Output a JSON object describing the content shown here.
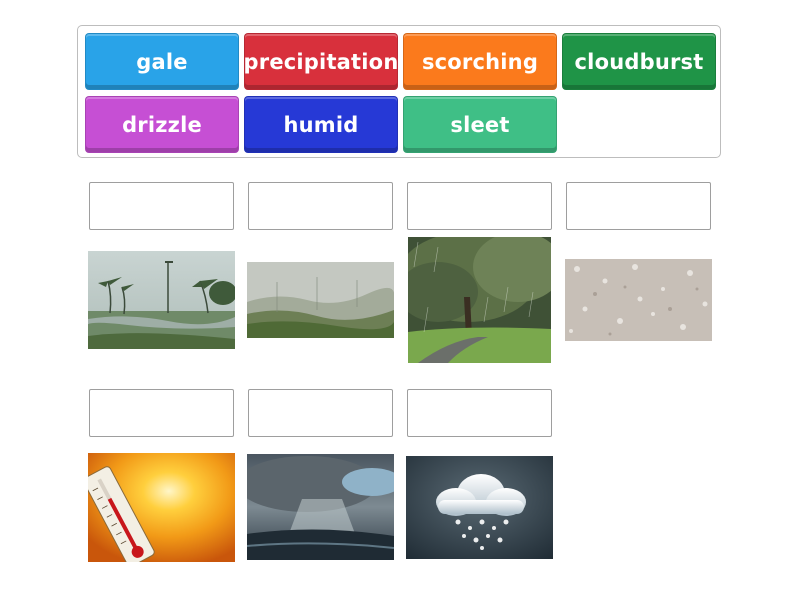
{
  "word_bank": {
    "tiles": [
      {
        "label": "gale",
        "color": "#29a3e8"
      },
      {
        "label": "precipitation",
        "color": "#d8303c"
      },
      {
        "label": "scorching",
        "color": "#fb7a1c"
      },
      {
        "label": "cloudburst",
        "color": "#1f9447"
      },
      {
        "label": "drizzle",
        "color": "#c64fd4"
      },
      {
        "label": "humid",
        "color": "#2639d6"
      },
      {
        "label": "sleet",
        "color": "#3fbf86"
      }
    ]
  },
  "images": [
    {
      "icon": "windswept-palm-trees-image"
    },
    {
      "icon": "misty-forest-image"
    },
    {
      "icon": "rainy-park-tree-image"
    },
    {
      "icon": "icy-ground-image"
    },
    {
      "icon": "hot-sun-thermometer-image"
    },
    {
      "icon": "storm-cloud-rain-image"
    },
    {
      "icon": "snow-cloud-icon-image"
    }
  ]
}
